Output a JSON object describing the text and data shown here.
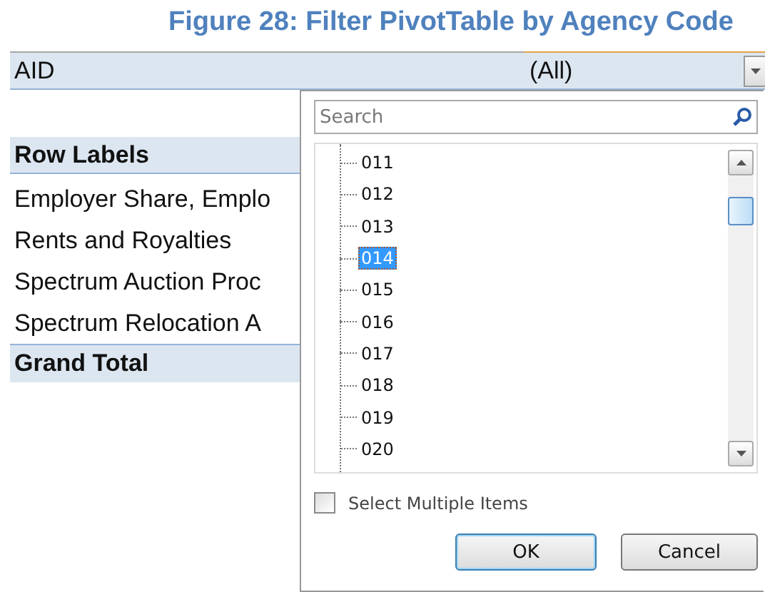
{
  "caption": "Figure 28: Filter PivotTable by Agency Code",
  "filter": {
    "field": "AID",
    "value": "(All)"
  },
  "table": {
    "header": "Row Labels",
    "rows": [
      "Employer Share, Emplo",
      "Rents and Royalties",
      "Spectrum Auction Proc",
      "Spectrum Relocation A"
    ],
    "total": "Grand Total"
  },
  "popup": {
    "search": {
      "placeholder": "Search"
    },
    "items": [
      {
        "label": "011",
        "selected": false
      },
      {
        "label": "012",
        "selected": false
      },
      {
        "label": "013",
        "selected": false
      },
      {
        "label": "014",
        "selected": true
      },
      {
        "label": "015",
        "selected": false
      },
      {
        "label": "016",
        "selected": false
      },
      {
        "label": "017",
        "selected": false
      },
      {
        "label": "018",
        "selected": false
      },
      {
        "label": "019",
        "selected": false
      },
      {
        "label": "020",
        "selected": false
      }
    ],
    "multiple": {
      "label": "Select Multiple Items",
      "checked": false
    },
    "buttons": [
      {
        "label": "OK",
        "kind": "default"
      },
      {
        "label": "Cancel",
        "kind": "normal"
      }
    ]
  }
}
